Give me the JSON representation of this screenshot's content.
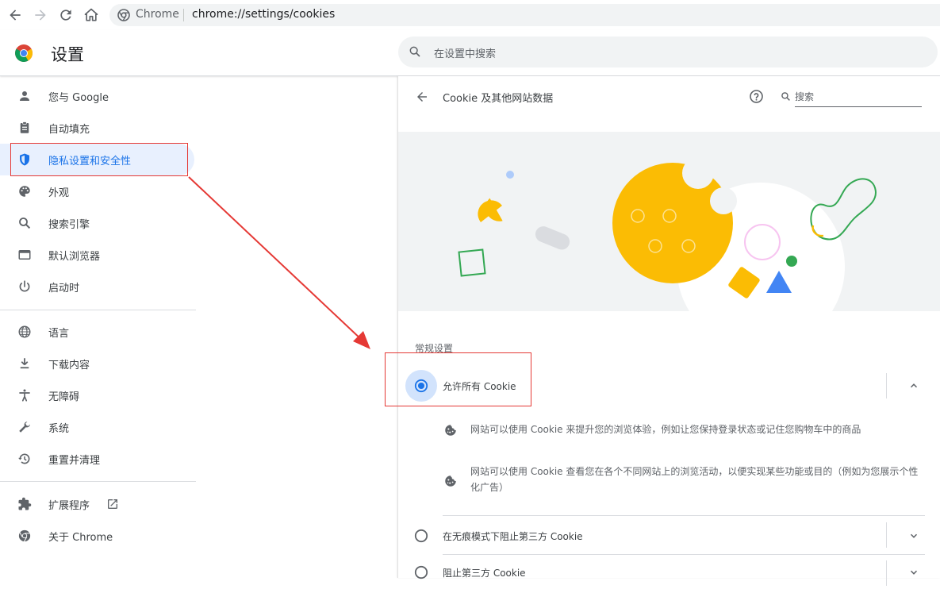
{
  "browser": {
    "url_scheme": "Chrome",
    "url_path": "chrome://settings/cookies"
  },
  "header": {
    "title": "设置",
    "search_placeholder": "在设置中搜索"
  },
  "sidebar": {
    "items": [
      {
        "label": "您与 Google",
        "icon": "person-icon"
      },
      {
        "label": "自动填充",
        "icon": "clipboard-icon"
      },
      {
        "label": "隐私设置和安全性",
        "icon": "shield-icon",
        "active": true
      },
      {
        "label": "外观",
        "icon": "palette-icon"
      },
      {
        "label": "搜索引擎",
        "icon": "search-icon"
      },
      {
        "label": "默认浏览器",
        "icon": "browser-window-icon"
      },
      {
        "label": "启动时",
        "icon": "power-icon"
      },
      {
        "label": "语言",
        "icon": "globe-icon"
      },
      {
        "label": "下载内容",
        "icon": "download-icon"
      },
      {
        "label": "无障碍",
        "icon": "accessibility-icon"
      },
      {
        "label": "系统",
        "icon": "wrench-icon"
      },
      {
        "label": "重置并清理",
        "icon": "history-icon"
      },
      {
        "label": "扩展程序",
        "icon": "puzzle-icon"
      },
      {
        "label": "关于 Chrome",
        "icon": "chrome-icon"
      }
    ]
  },
  "content": {
    "heading": "Cookie 及其他网站数据",
    "search_label": "搜索",
    "section_label": "常规设置",
    "options": [
      {
        "label": "允许所有 Cookie",
        "selected": true,
        "expanded": true
      },
      {
        "label": "在无痕模式下阻止第三方 Cookie",
        "selected": false,
        "expanded": false
      },
      {
        "label": "阻止第三方 Cookie",
        "selected": false,
        "expanded": false
      }
    ],
    "details": [
      "网站可以使用 Cookie 来提升您的浏览体验，例如让您保持登录状态或记住您购物车中的商品",
      "网站可以使用 Cookie 查看您在各个不同网站上的浏览活动，以便实现某些功能或目的（例如为您展示个性化广告）"
    ]
  },
  "colors": {
    "accent": "#1a73e8",
    "active_bg": "#e8f0fe",
    "annotation": "#e53935"
  }
}
